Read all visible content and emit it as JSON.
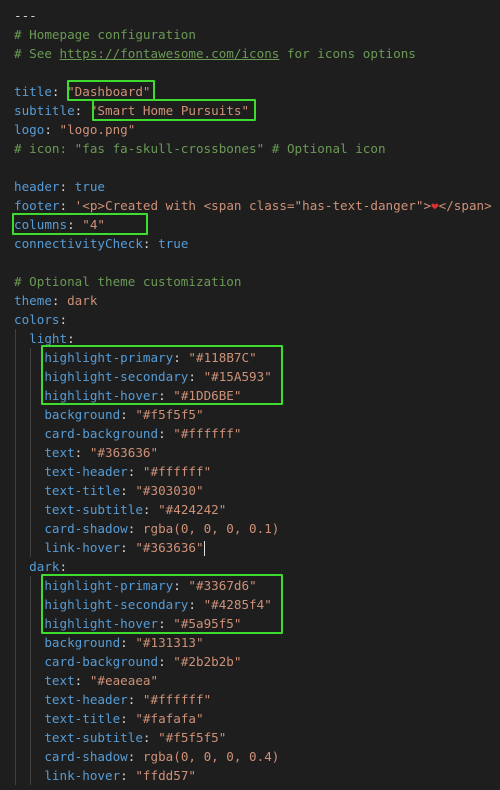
{
  "editor": {
    "lines": [
      [
        {
          "t": "---",
          "c": "p"
        }
      ],
      [
        {
          "t": "# Homepage configuration",
          "c": "c"
        }
      ],
      [
        {
          "t": "# See ",
          "c": "c"
        },
        {
          "t": "https://fontawesome.com/icons",
          "c": "c u"
        },
        {
          "t": " for icons options",
          "c": "c"
        }
      ],
      [],
      [
        {
          "t": "title",
          "c": "k"
        },
        {
          "t": ": ",
          "c": "p"
        },
        {
          "t": "\"Dashboard\"",
          "c": "s"
        }
      ],
      [
        {
          "t": "subtitle",
          "c": "k"
        },
        {
          "t": ": ",
          "c": "p"
        },
        {
          "t": "\"Smart Home Pursuits\"",
          "c": "s"
        }
      ],
      [
        {
          "t": "logo",
          "c": "k"
        },
        {
          "t": ": ",
          "c": "p"
        },
        {
          "t": "\"logo.png\"",
          "c": "s"
        }
      ],
      [
        {
          "t": "# icon: \"fas fa-skull-crossbones\" # Optional icon",
          "c": "c"
        }
      ],
      [],
      [
        {
          "t": "header",
          "c": "k"
        },
        {
          "t": ": ",
          "c": "p"
        },
        {
          "t": "true",
          "c": "k"
        }
      ],
      [
        {
          "t": "footer",
          "c": "k"
        },
        {
          "t": ": ",
          "c": "p"
        },
        {
          "t": "'<p>Created with <span class=\"has-text-danger\">",
          "c": "s"
        },
        {
          "t": "❤",
          "c": "heart"
        },
        {
          "t": "</span>",
          "c": "s"
        }
      ],
      [
        {
          "t": "columns",
          "c": "k"
        },
        {
          "t": ": ",
          "c": "p"
        },
        {
          "t": "\"4\"",
          "c": "s"
        }
      ],
      [
        {
          "t": "connectivityCheck",
          "c": "k"
        },
        {
          "t": ": ",
          "c": "p"
        },
        {
          "t": "true",
          "c": "k"
        }
      ],
      [],
      [
        {
          "t": "# Optional theme customization",
          "c": "c"
        }
      ],
      [
        {
          "t": "theme",
          "c": "k"
        },
        {
          "t": ": ",
          "c": "p"
        },
        {
          "t": "dark",
          "c": "s"
        }
      ],
      [
        {
          "t": "colors",
          "c": "k"
        },
        {
          "t": ":",
          "c": "p"
        }
      ],
      [
        {
          "t": "  light",
          "c": "k"
        },
        {
          "t": ":",
          "c": "p"
        }
      ],
      [
        {
          "t": "    highlight-primary",
          "c": "k"
        },
        {
          "t": ": ",
          "c": "p"
        },
        {
          "t": "\"#118B7C\"",
          "c": "s"
        }
      ],
      [
        {
          "t": "    highlight-secondary",
          "c": "k"
        },
        {
          "t": ": ",
          "c": "p"
        },
        {
          "t": "\"#15A593\"",
          "c": "s"
        }
      ],
      [
        {
          "t": "    highlight-hover",
          "c": "k"
        },
        {
          "t": ": ",
          "c": "p"
        },
        {
          "t": "\"#1DD6BE\"",
          "c": "s"
        }
      ],
      [
        {
          "t": "    background",
          "c": "k"
        },
        {
          "t": ": ",
          "c": "p"
        },
        {
          "t": "\"#f5f5f5\"",
          "c": "s"
        }
      ],
      [
        {
          "t": "    card-background",
          "c": "k"
        },
        {
          "t": ": ",
          "c": "p"
        },
        {
          "t": "\"#ffffff\"",
          "c": "s"
        }
      ],
      [
        {
          "t": "    text",
          "c": "k"
        },
        {
          "t": ": ",
          "c": "p"
        },
        {
          "t": "\"#363636\"",
          "c": "s"
        }
      ],
      [
        {
          "t": "    text-header",
          "c": "k"
        },
        {
          "t": ": ",
          "c": "p"
        },
        {
          "t": "\"#ffffff\"",
          "c": "s"
        }
      ],
      [
        {
          "t": "    text-title",
          "c": "k"
        },
        {
          "t": ": ",
          "c": "p"
        },
        {
          "t": "\"#303030\"",
          "c": "s"
        }
      ],
      [
        {
          "t": "    text-subtitle",
          "c": "k"
        },
        {
          "t": ": ",
          "c": "p"
        },
        {
          "t": "\"#424242\"",
          "c": "s"
        }
      ],
      [
        {
          "t": "    card-shadow",
          "c": "k"
        },
        {
          "t": ": ",
          "c": "p"
        },
        {
          "t": "rgba(0, 0, 0, 0.1)",
          "c": "s"
        }
      ],
      [
        {
          "t": "    link-hover",
          "c": "k"
        },
        {
          "t": ": ",
          "c": "p"
        },
        {
          "t": "\"#363636\"",
          "c": "s"
        }
      ],
      [
        {
          "t": "  dark",
          "c": "k"
        },
        {
          "t": ":",
          "c": "p"
        }
      ],
      [
        {
          "t": "    highlight-primary",
          "c": "k"
        },
        {
          "t": ": ",
          "c": "p"
        },
        {
          "t": "\"#3367d6\"",
          "c": "s"
        }
      ],
      [
        {
          "t": "    highlight-secondary",
          "c": "k"
        },
        {
          "t": ": ",
          "c": "p"
        },
        {
          "t": "\"#4285f4\"",
          "c": "s"
        }
      ],
      [
        {
          "t": "    highlight-hover",
          "c": "k"
        },
        {
          "t": ": ",
          "c": "p"
        },
        {
          "t": "\"#5a95f5\"",
          "c": "s"
        }
      ],
      [
        {
          "t": "    background",
          "c": "k"
        },
        {
          "t": ": ",
          "c": "p"
        },
        {
          "t": "\"#131313\"",
          "c": "s"
        }
      ],
      [
        {
          "t": "    card-background",
          "c": "k"
        },
        {
          "t": ": ",
          "c": "p"
        },
        {
          "t": "\"#2b2b2b\"",
          "c": "s"
        }
      ],
      [
        {
          "t": "    text",
          "c": "k"
        },
        {
          "t": ": ",
          "c": "p"
        },
        {
          "t": "\"#eaeaea\"",
          "c": "s"
        }
      ],
      [
        {
          "t": "    text-header",
          "c": "k"
        },
        {
          "t": ": ",
          "c": "p"
        },
        {
          "t": "\"#ffffff\"",
          "c": "s"
        }
      ],
      [
        {
          "t": "    text-title",
          "c": "k"
        },
        {
          "t": ": ",
          "c": "p"
        },
        {
          "t": "\"#fafafa\"",
          "c": "s"
        }
      ],
      [
        {
          "t": "    text-subtitle",
          "c": "k"
        },
        {
          "t": ": ",
          "c": "p"
        },
        {
          "t": "\"#f5f5f5\"",
          "c": "s"
        }
      ],
      [
        {
          "t": "    card-shadow",
          "c": "k"
        },
        {
          "t": ": ",
          "c": "p"
        },
        {
          "t": "rgba(0, 0, 0, 0.4)",
          "c": "s"
        }
      ],
      [
        {
          "t": "    link-hover",
          "c": "k"
        },
        {
          "t": ": ",
          "c": "p"
        },
        {
          "t": "\"ffdd57\"",
          "c": "s"
        }
      ]
    ]
  },
  "colors": {
    "background": "#1e1e1e",
    "key": "#569cd6",
    "string": "#ce9178",
    "comment": "#6a9955",
    "highlight_box": "#3ddc2f",
    "heart": "#e03131"
  }
}
